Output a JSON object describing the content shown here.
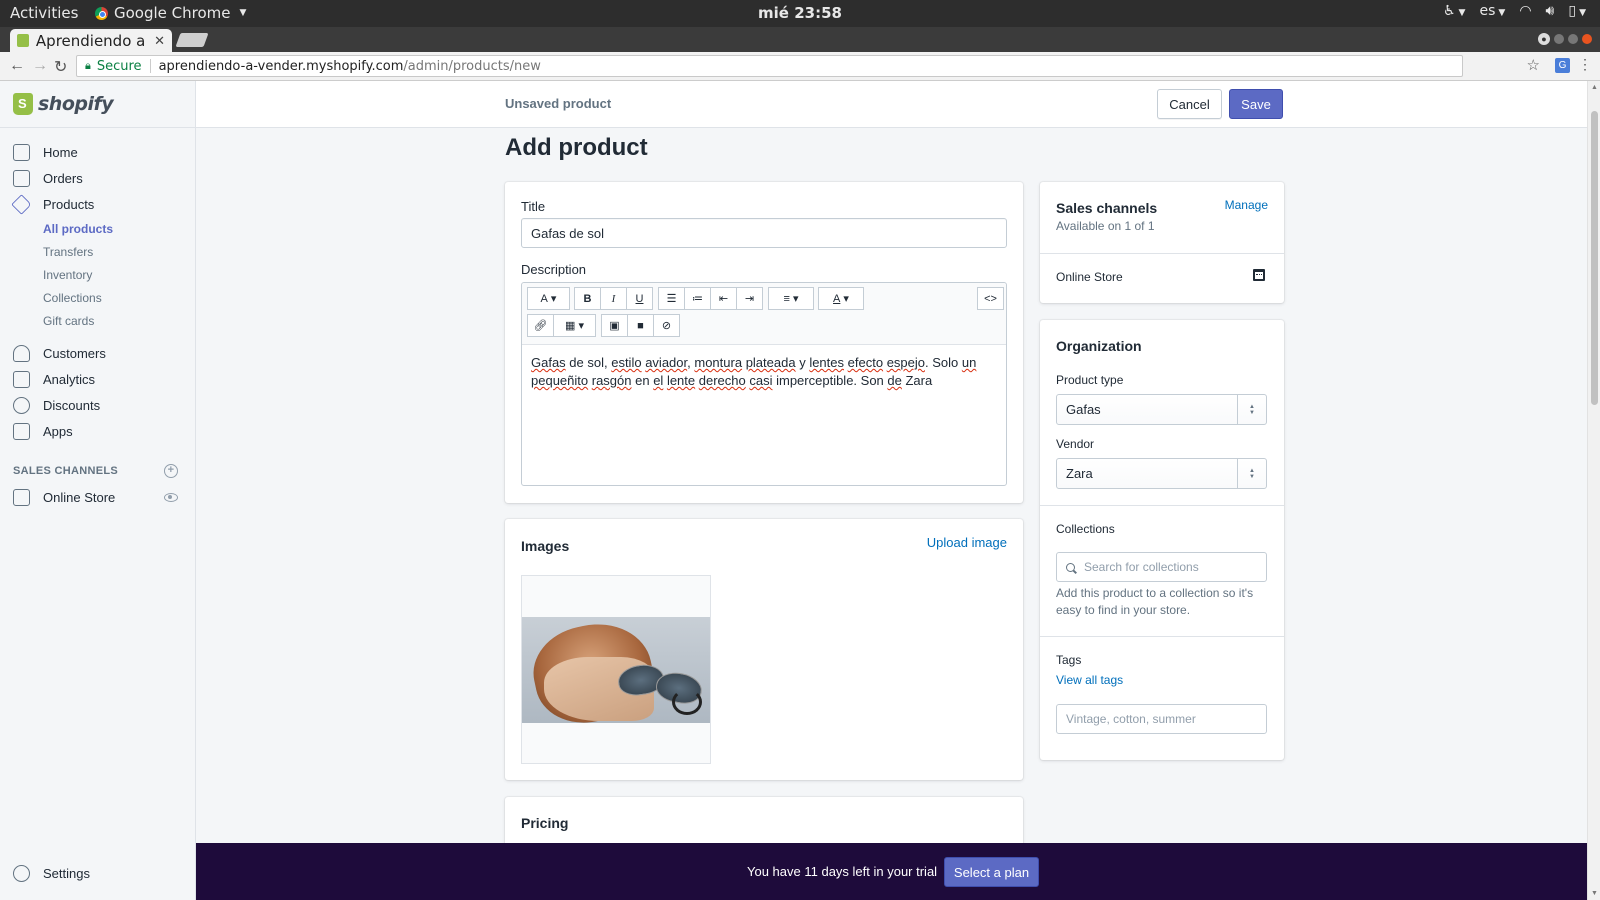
{
  "gnome": {
    "activities": "Activities",
    "app_name": "Google Chrome",
    "clock": "mié 23:58",
    "language": "es"
  },
  "browser": {
    "tab_title": "Aprendiendo a",
    "secure_label": "Secure",
    "url_host": "aprendiendo-a-vender.myshopify.com",
    "url_path": "/admin/products/new"
  },
  "sidebar": {
    "logo": "shopify",
    "items": [
      {
        "label": "Home"
      },
      {
        "label": "Orders"
      },
      {
        "label": "Products"
      },
      {
        "label": "Customers"
      },
      {
        "label": "Analytics"
      },
      {
        "label": "Discounts"
      },
      {
        "label": "Apps"
      }
    ],
    "product_subitems": [
      {
        "label": "All products"
      },
      {
        "label": "Transfers"
      },
      {
        "label": "Inventory"
      },
      {
        "label": "Collections"
      },
      {
        "label": "Gift cards"
      }
    ],
    "sales_channels_heading": "SALES CHANNELS",
    "online_store": "Online Store",
    "settings": "Settings"
  },
  "topbar": {
    "status": "Unsaved product",
    "cancel": "Cancel",
    "save": "Save"
  },
  "page": {
    "title": "Add product"
  },
  "product": {
    "title_label": "Title",
    "title_value": "Gafas de sol",
    "description_label": "Description",
    "description_words": [
      {
        "t": "Gafas",
        "u": true
      },
      {
        "t": " de sol, ",
        "u": false
      },
      {
        "t": "estilo",
        "u": true
      },
      {
        "t": " ",
        "u": false
      },
      {
        "t": "aviador",
        "u": true
      },
      {
        "t": ", ",
        "u": false
      },
      {
        "t": "montura",
        "u": true
      },
      {
        "t": " ",
        "u": false
      },
      {
        "t": "plateada",
        "u": true
      },
      {
        "t": " y ",
        "u": false
      },
      {
        "t": "lentes",
        "u": true
      },
      {
        "t": " ",
        "u": false
      },
      {
        "t": "efecto",
        "u": true
      },
      {
        "t": " ",
        "u": false
      },
      {
        "t": "espejo",
        "u": true
      },
      {
        "t": ". Solo ",
        "u": false
      },
      {
        "t": "un",
        "u": true
      },
      {
        "t": " ",
        "u": false
      },
      {
        "t": "pequeñito",
        "u": true
      },
      {
        "t": " ",
        "u": false
      },
      {
        "t": "rasgón",
        "u": true
      },
      {
        "t": " en ",
        "u": false
      },
      {
        "t": "el",
        "u": true
      },
      {
        "t": " ",
        "u": false
      },
      {
        "t": "lente",
        "u": true
      },
      {
        "t": " ",
        "u": false
      },
      {
        "t": "derecho",
        "u": true
      },
      {
        "t": " ",
        "u": false
      },
      {
        "t": "casi",
        "u": true
      },
      {
        "t": " imperceptible. Son ",
        "u": false
      },
      {
        "t": "de",
        "u": true
      },
      {
        "t": " Zara",
        "u": false
      }
    ],
    "toolbar": {
      "font": "A",
      "bold": "B",
      "italic": "I",
      "underline": "U",
      "text_color": "A",
      "html": "<>"
    }
  },
  "images": {
    "heading": "Images",
    "upload": "Upload image"
  },
  "pricing": {
    "heading": "Pricing"
  },
  "sales_channels": {
    "heading": "Sales channels",
    "manage": "Manage",
    "availability": "Available on 1 of 1",
    "online_store": "Online Store"
  },
  "organization": {
    "heading": "Organization",
    "product_type_label": "Product type",
    "product_type_value": "Gafas",
    "vendor_label": "Vendor",
    "vendor_value": "Zara",
    "collections_label": "Collections",
    "collections_placeholder": "Search for collections",
    "collections_help": "Add this product to a collection so it's easy to find in your store.",
    "tags_label": "Tags",
    "view_all_tags": "View all tags",
    "tags_placeholder": "Vintage, cotton, summer"
  },
  "trial": {
    "message": "You have 11 days left in your trial",
    "button": "Select a plan"
  },
  "colors": {
    "accent": "#5c6ac4",
    "link": "#006fbb",
    "trial_bg": "#1e0b3b",
    "shopify_green": "#95bf47"
  }
}
